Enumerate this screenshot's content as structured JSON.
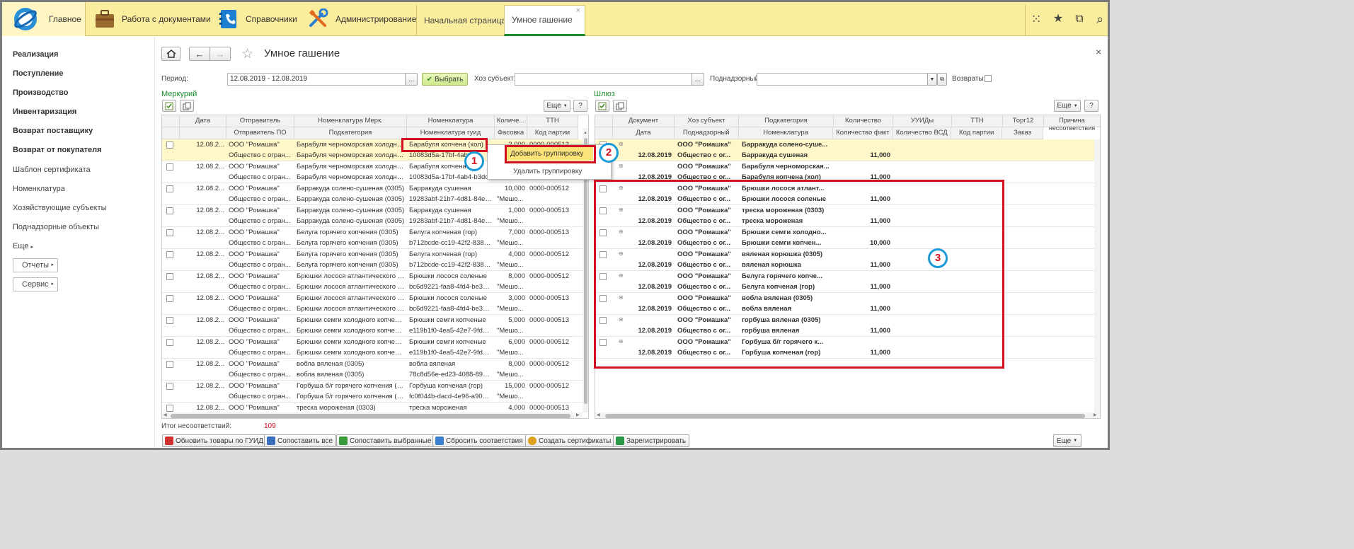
{
  "topbar": {
    "sections": [
      {
        "label": "Главное",
        "icon": "logo-icon"
      },
      {
        "label": "Работа с документами",
        "icon": "briefcase-icon"
      },
      {
        "label": "Справочники",
        "icon": "address-book-icon"
      },
      {
        "label": "Администрирование",
        "icon": "tools-icon"
      }
    ],
    "tabs": [
      {
        "label": "Начальная страница"
      },
      {
        "label": "Умное гашение",
        "close": "×"
      }
    ],
    "right_icons": [
      "apps-grid-icon",
      "favorites-star-icon",
      "history-icon",
      "search-icon"
    ],
    "icon_glyphs": {
      "apps": "⁙",
      "star": "★",
      "history": "⧉",
      "search": "⌕"
    }
  },
  "sidebar": {
    "items": [
      {
        "label": "Реализация",
        "bold": true
      },
      {
        "label": "Поступление",
        "bold": true
      },
      {
        "label": "Производство",
        "bold": true
      },
      {
        "label": "Инвентаризация",
        "bold": true
      },
      {
        "label": "Возврат поставщику",
        "bold": true
      },
      {
        "label": "Возврат от покупателя",
        "bold": true
      },
      {
        "label": "Шаблон сертификата",
        "bold": false
      },
      {
        "label": "Номенклатура",
        "bold": false
      },
      {
        "label": "Хозяйствующие субъекты",
        "bold": false
      },
      {
        "label": "Поднадзорные объекты",
        "bold": false
      },
      {
        "label": "Еще",
        "bold": false
      }
    ],
    "buttons": [
      {
        "label": "Отчеты"
      },
      {
        "label": "Сервис"
      }
    ]
  },
  "page": {
    "title": "Умное гашение",
    "close": "×",
    "period_label": "Период:",
    "period_value": "12.08.2019 - 12.08.2019",
    "select_label": "Выбрать",
    "subject_label": "Хоз субъект:",
    "subject_value": "",
    "supervised_label": "Поднадзорный:",
    "supervised_value": "",
    "returns_label": "Возвраты:",
    "ellipsis": "...",
    "more_label": "Еще",
    "help_label": "?"
  },
  "left_panel": {
    "title": "Меркурий",
    "headers_top": [
      "Дата",
      "Отправитель",
      "Номенклатура Мерк.",
      "Номенклатура",
      "Количе...",
      "ТТН"
    ],
    "headers_bottom": [
      "",
      "Отправитель ПО",
      "Подкатегория",
      "Номенклатура гуид",
      "Фасовка",
      "Код партии"
    ],
    "rows": [
      {
        "date": "12.08.2...",
        "sender": "ООО \"Ромашка\"",
        "sender_po": "Общество с огран...",
        "nom_merk": "Барабуля черноморская холодног...",
        "subcat": "Барабуля черноморская холодног...",
        "nom": "Барабуля копчена (хол)",
        "guid": "10083d5a-17bf-4ab4-",
        "qty": "2,000",
        "pack": "",
        "ttn": "0000-000513",
        "batch": ""
      },
      {
        "date": "12.08.2...",
        "sender": "ООО \"Ромашка\"",
        "sender_po": "Общество с огран...",
        "nom_merk": "Барабуля черноморская холодног...",
        "subcat": "Барабуля черноморская холодног...",
        "nom": "Барабуля копчена",
        "guid": "10083d5a-17bf-4ab4-b3dc-",
        "qty": "",
        "pack": "",
        "ttn": "",
        "batch": ""
      },
      {
        "date": "12.08.2...",
        "sender": "ООО \"Ромашка\"",
        "sender_po": "Общество с огран...",
        "nom_merk": "Барракуда солено-сушеная (0305)",
        "subcat": "Барракуда солено-сушеная (0305)",
        "nom": "Барракуда сушеная",
        "guid": "19283abf-21b7-4d81-84ec-...",
        "qty": "10,000",
        "pack": "\"Мешо...",
        "ttn": "0000-000512",
        "batch": ""
      },
      {
        "date": "12.08.2...",
        "sender": "ООО \"Ромашка\"",
        "sender_po": "Общество с огран...",
        "nom_merk": "Барракуда солено-сушеная (0305)",
        "subcat": "Барракуда солено-сушеная (0305)",
        "nom": "Барракуда сушеная",
        "guid": "19283abf-21b7-4d81-84ec-...",
        "qty": "1,000",
        "pack": "\"Мешо...",
        "ttn": "0000-000513",
        "batch": ""
      },
      {
        "date": "12.08.2...",
        "sender": "ООО \"Ромашка\"",
        "sender_po": "Общество с огран...",
        "nom_merk": "Белуга горячего копчения (0305)",
        "subcat": "Белуга горячего копчения (0305)",
        "nom": "Белуга копченая (гор)",
        "guid": "b712bcde-cc19-42f2-8381-...",
        "qty": "7,000",
        "pack": "\"Мешо...",
        "ttn": "0000-000513",
        "batch": ""
      },
      {
        "date": "12.08.2...",
        "sender": "ООО \"Ромашка\"",
        "sender_po": "Общество с огран...",
        "nom_merk": "Белуга горячего копчения (0305)",
        "subcat": "Белуга горячего копчения (0305)",
        "nom": "Белуга копченая (гор)",
        "guid": "b712bcde-cc19-42f2-8381-...",
        "qty": "4,000",
        "pack": "\"Мешо...",
        "ttn": "0000-000512",
        "batch": ""
      },
      {
        "date": "12.08.2...",
        "sender": "ООО \"Ромашка\"",
        "sender_po": "Общество с огран...",
        "nom_merk": "Брюшки лосося атлантического с...",
        "subcat": "Брюшки лосося атлантического с...",
        "nom": "Брюшки лосося соленые",
        "guid": "bc6d9221-faa8-4fd4-be3c-f...",
        "qty": "8,000",
        "pack": "\"Мешо...",
        "ttn": "0000-000512",
        "batch": ""
      },
      {
        "date": "12.08.2...",
        "sender": "ООО \"Ромашка\"",
        "sender_po": "Общество с огран...",
        "nom_merk": "Брюшки лосося атлантического с...",
        "subcat": "Брюшки лосося атлантического с...",
        "nom": "Брюшки лосося соленые",
        "guid": "bc6d9221-faa8-4fd4-be3c-f...",
        "qty": "3,000",
        "pack": "\"Мешо...",
        "ttn": "0000-000513",
        "batch": ""
      },
      {
        "date": "12.08.2...",
        "sender": "ООО \"Ромашка\"",
        "sender_po": "Общество с огран...",
        "nom_merk": "Брюшки семги холодного копчени...",
        "subcat": "Брюшки семги холодного копчени...",
        "nom": "Брюшки семги копченые",
        "guid": "e119b1f0-4ea5-42e7-9fda-4...",
        "qty": "5,000",
        "pack": "\"Мешо...",
        "ttn": "0000-000513",
        "batch": ""
      },
      {
        "date": "12.08.2...",
        "sender": "ООО \"Ромашка\"",
        "sender_po": "Общество с огран...",
        "nom_merk": "Брюшки семги холодного копчени...",
        "subcat": "Брюшки семги холодного копчени...",
        "nom": "Брюшки семги копченые",
        "guid": "e119b1f0-4ea5-42e7-9fda-4...",
        "qty": "6,000",
        "pack": "\"Мешо...",
        "ttn": "0000-000512",
        "batch": ""
      },
      {
        "date": "12.08.2...",
        "sender": "ООО \"Ромашка\"",
        "sender_po": "Общество с огран...",
        "nom_merk": "вобла вяленая (0305)",
        "subcat": "вобла вяленая (0305)",
        "nom": "вобла вяленая",
        "guid": "78c8d56e-ed23-4088-893a-...",
        "qty": "8,000",
        "pack": "\"Мешо...",
        "ttn": "0000-000512",
        "batch": ""
      },
      {
        "date": "12.08.2...",
        "sender": "ООО \"Ромашка\"",
        "sender_po": "Общество с огран...",
        "nom_merk": "Горбуша б/г горячего копчения (0...",
        "subcat": "Горбуша б/г горячего копчения (0...",
        "nom": "Горбуша копченая (гор)",
        "guid": "fc0f044b-dacd-4e96-a909-3...",
        "qty": "15,000",
        "pack": "\"Мешо...",
        "ttn": "0000-000512",
        "batch": ""
      },
      {
        "date": "12.08.2...",
        "sender": "ООО \"Ромашка\"",
        "sender_po": "",
        "nom_merk": "треска мороженая (0303)",
        "subcat": "",
        "nom": "треска мороженая",
        "guid": "",
        "qty": "4,000",
        "pack": "",
        "ttn": "0000-000513",
        "batch": ""
      }
    ]
  },
  "context_menu": {
    "items": [
      {
        "label": "Добавить группировку"
      },
      {
        "label": "Удалить группировку"
      }
    ]
  },
  "right_panel": {
    "title": "Шлюз",
    "headers_top": [
      "Документ",
      "Хоз субъект",
      "Подкатегория",
      "Количество",
      "УУИДы",
      "ТТН",
      "Торг12",
      "Причина несоответствия"
    ],
    "headers_bottom": [
      "Дата",
      "Поднадзорный",
      "Номенклатура",
      "Количество факт",
      "Количество ВСД",
      "Код партии",
      "Заказ",
      ""
    ],
    "rows": [
      {
        "date": "12.08.2019",
        "subject": "ООО \"Ромашка\"",
        "supervised": "Общество с ог...",
        "subcat": "Барракуда солено-суше...",
        "nom": "Барракуда сушеная",
        "qty": "11,000",
        "highlight": true
      },
      {
        "date": "12.08.2019",
        "subject": "ООО \"Ромашка\"",
        "supervised": "Общество с ог...",
        "subcat": "Барабуля черноморская...",
        "nom": "Барабуля копчена (хол)",
        "qty": "11,000",
        "highlight": false
      },
      {
        "date": "12.08.2019",
        "subject": "ООО \"Ромашка\"",
        "supervised": "Общество с ог...",
        "subcat": "Брюшки лосося атлант...",
        "nom": "Брюшки лосося соленые",
        "qty": "11,000",
        "highlight": false
      },
      {
        "date": "12.08.2019",
        "subject": "ООО \"Ромашка\"",
        "supervised": "Общество с ог...",
        "subcat": "треска мороженая (0303)",
        "nom": "треска мороженая",
        "qty": "11,000",
        "highlight": false
      },
      {
        "date": "12.08.2019",
        "subject": "ООО \"Ромашка\"",
        "supervised": "Общество с ог...",
        "subcat": "Брюшки семги холодно...",
        "nom": "Брюшки семги  копчен...",
        "qty": "10,000",
        "highlight": false
      },
      {
        "date": "12.08.2019",
        "subject": "ООО \"Ромашка\"",
        "supervised": "Общество с ог...",
        "subcat": "вяленая корюшка (0305)",
        "nom": "вяленая корюшка",
        "qty": "11,000",
        "highlight": false
      },
      {
        "date": "12.08.2019",
        "subject": "ООО \"Ромашка\"",
        "supervised": "Общество с ог...",
        "subcat": "Белуга горячего копче...",
        "nom": "Белуга копченая (гор)",
        "qty": "11,000",
        "highlight": false
      },
      {
        "date": "12.08.2019",
        "subject": "ООО \"Ромашка\"",
        "supervised": "Общество с ог...",
        "subcat": "вобла вяленая (0305)",
        "nom": "вобла вяленая",
        "qty": "11,000",
        "highlight": false
      },
      {
        "date": "12.08.2019",
        "subject": "ООО \"Ромашка\"",
        "supervised": "Общество с ог...",
        "subcat": "горбуша вяленая (0305)",
        "nom": "горбуша вяленая",
        "qty": "11,000",
        "highlight": false
      },
      {
        "date": "12.08.2019",
        "subject": "ООО \"Ромашка\"",
        "supervised": "Общество с ог...",
        "subcat": "Горбуша б/г горячего к...",
        "nom": "Горбуша копченая (гор)",
        "qty": "11,000",
        "highlight": false
      }
    ]
  },
  "footer": {
    "mismatch_label": "Итог несоответствий:",
    "mismatch_value": "109",
    "buttons": [
      {
        "label": "Обновить товары по ГУИД",
        "color": "#d03030"
      },
      {
        "label": "Сопоставить все",
        "color": "#3a6fc0"
      },
      {
        "label": "Сопоставить выбранные",
        "color": "#3a9a3a"
      },
      {
        "label": "Сбросить соответствия",
        "color": "#3a7fd0"
      },
      {
        "label": "Создать сертификаты",
        "color": "#e0a020"
      },
      {
        "label": "Зарегистрировать",
        "color": "#2a9a4a"
      }
    ],
    "more_label": "Еще"
  },
  "annotations": {
    "step1": "1",
    "step2": "2",
    "step3": "3"
  },
  "colors": {
    "accent_yellow": "#fbed9e",
    "highlight_row": "#fff7c9",
    "annotation_red": "#d01020",
    "annotation_blue": "#1a9ad6",
    "green_label": "#1a8b2c"
  }
}
